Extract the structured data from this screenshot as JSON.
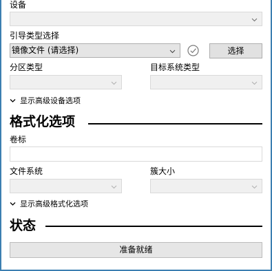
{
  "drive_properties": {
    "device_label": "设备",
    "device_value": "",
    "boot_selection_label": "引导类型选择",
    "boot_selection_value": "镜像文件 (请选择)",
    "select_button_label": "选择",
    "partition_scheme_label": "分区类型",
    "partition_scheme_value": "",
    "target_system_label": "目标系统类型",
    "target_system_value": "",
    "advanced_drive_toggle": "显示高级设备选项"
  },
  "format_options": {
    "section_title": "格式化选项",
    "volume_label_label": "卷标",
    "volume_label_value": "",
    "file_system_label": "文件系统",
    "file_system_value": "",
    "cluster_size_label": "簇大小",
    "cluster_size_value": "",
    "advanced_format_toggle": "显示高级格式化选项"
  },
  "status": {
    "section_title": "状态",
    "progress_text": "准备就绪",
    "progress_fraction": 0
  },
  "icons": {
    "dropdown": "chevron-down-icon",
    "verify": "check-circle-icon",
    "expand": "chevron-down-icon"
  },
  "colors": {
    "window_border": "#3c7fb1",
    "control_disabled_bg": "#f0f0f0",
    "control_border": "#d9d9d9",
    "button_bg": "#e1e1e1"
  }
}
